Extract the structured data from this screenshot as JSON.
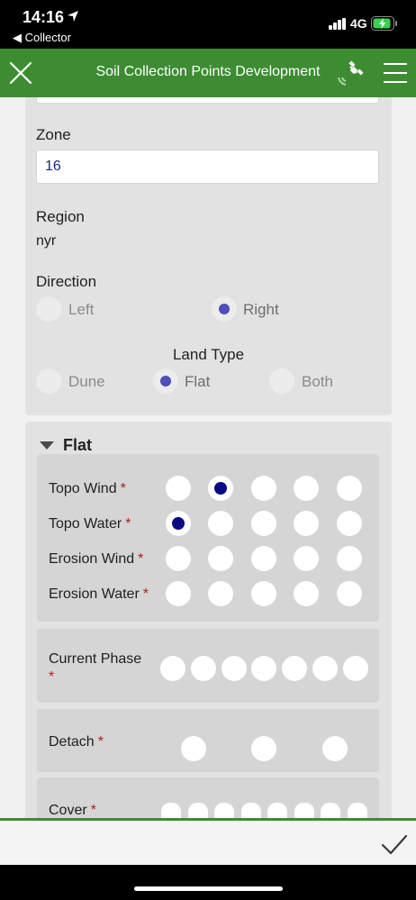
{
  "status_bar": {
    "time": "14:16",
    "back_app": "◀ Collector",
    "network": "4G"
  },
  "header": {
    "title": "Soil Collection Points Development"
  },
  "form": {
    "zone": {
      "label": "Zone",
      "value": "16"
    },
    "region": {
      "label": "Region",
      "value": "nyr"
    },
    "direction": {
      "label": "Direction",
      "options": [
        "Left",
        "Right"
      ],
      "selected": "Right"
    },
    "land_type": {
      "label": "Land Type",
      "options": [
        "Dune",
        "Flat",
        "Both"
      ],
      "selected": "Flat"
    }
  },
  "flat_section": {
    "title": "Flat",
    "rows": [
      {
        "label": "Topo Wind",
        "required": "*",
        "selected_index": 1
      },
      {
        "label": "Topo Water",
        "required": "*",
        "selected_index": 0
      },
      {
        "label": "Erosion Wind",
        "required": "*",
        "selected_index": -1
      },
      {
        "label": "Erosion Water",
        "required": "*",
        "selected_index": -1
      }
    ],
    "current_phase": {
      "label": "Current Phase",
      "required": "*"
    },
    "detach": {
      "label": "Detach",
      "required": "*"
    },
    "cover": {
      "label": "Cover",
      "required": "*"
    }
  },
  "icons": {
    "close": "close-icon",
    "gps": "gps-satellite-icon",
    "menu": "hamburger-menu-icon",
    "submit": "checkmark-icon",
    "collapse": "triangle-down-icon"
  },
  "colors": {
    "header_green": "#3d8c32",
    "radio_selected": "#4e4fb8",
    "choice_selected": "#0b0a85",
    "required_red": "#b21e1e",
    "zone_text": "#1a2a7a"
  }
}
